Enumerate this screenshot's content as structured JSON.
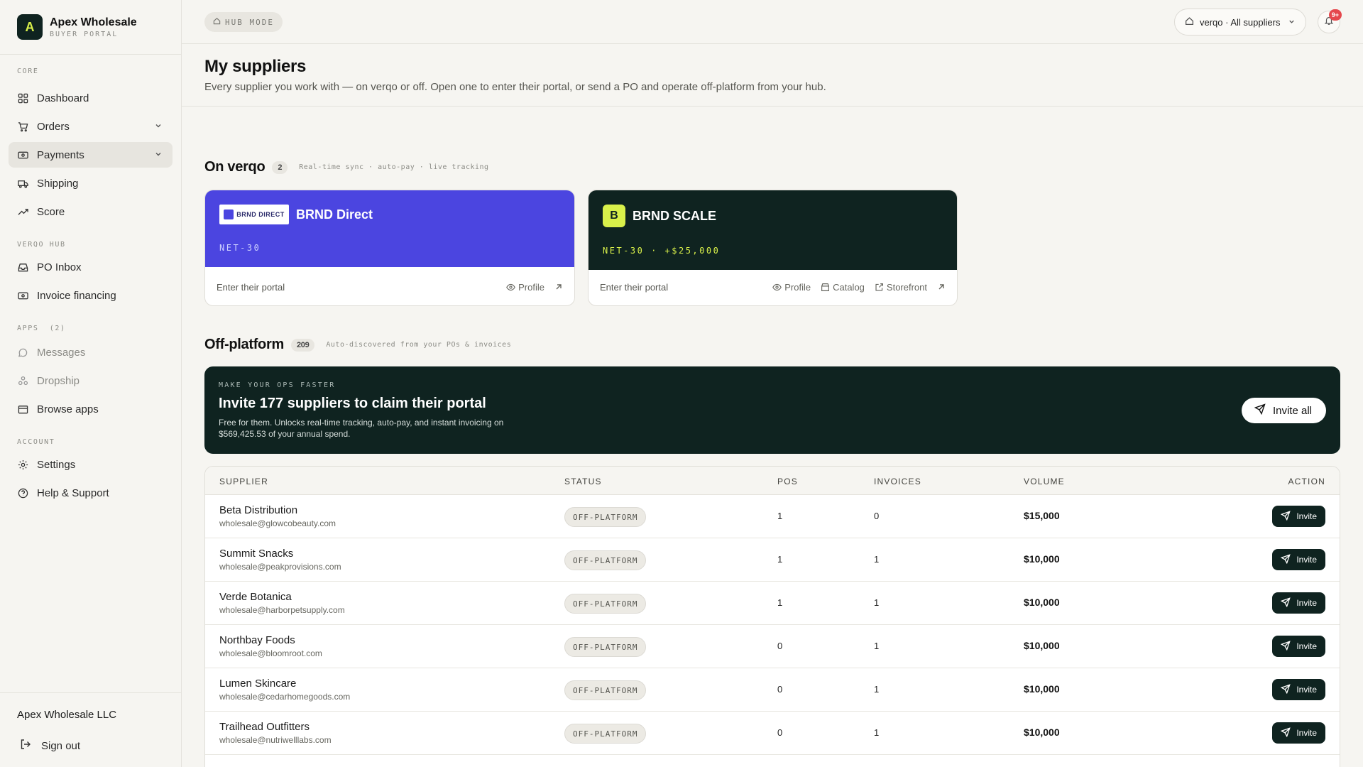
{
  "brand": {
    "initial": "A",
    "name": "Apex Wholesale",
    "sub": "BUYER PORTAL"
  },
  "nav": {
    "sections": [
      "CORE",
      "VERQO HUB",
      "APPS",
      "ACCOUNT"
    ],
    "apps_count": "(2)",
    "items": [
      {
        "label": "Dashboard"
      },
      {
        "label": "Orders"
      },
      {
        "label": "Payments"
      },
      {
        "label": "Shipping"
      },
      {
        "label": "Score"
      },
      {
        "label": "PO Inbox"
      },
      {
        "label": "Invoice financing"
      },
      {
        "label": "Messages"
      },
      {
        "label": "Dropship"
      },
      {
        "label": "Browse apps"
      },
      {
        "label": "Settings"
      },
      {
        "label": "Help & Support"
      }
    ]
  },
  "footer": {
    "company": "Apex Wholesale LLC",
    "signout": "Sign out"
  },
  "topbar": {
    "hub_mode": "HUB MODE",
    "scope": "verqo · All suppliers",
    "notif_count": "9+"
  },
  "page": {
    "title": "My suppliers",
    "subtitle": "Every supplier you work with — on verqo or off. Open one to enter their portal, or send a PO and operate off-platform from your hub."
  },
  "on_verqo": {
    "title": "On verqo",
    "count": "2",
    "note": "Real-time sync · auto-pay · live tracking",
    "cards": [
      {
        "logo_text": "BRND DIRECT",
        "name": "BRND Direct",
        "terms": "NET-30",
        "enter": "Enter their portal",
        "links": [
          "Profile"
        ]
      },
      {
        "logo_initial": "B",
        "name": "BRND SCALE",
        "terms": "NET-30 · +$25,000",
        "enter": "Enter their portal",
        "links": [
          "Profile",
          "Catalog",
          "Storefront"
        ]
      }
    ]
  },
  "off_platform": {
    "title": "Off-platform",
    "count": "209",
    "note": "Auto-discovered from your POs & invoices",
    "banner": {
      "kicker": "MAKE YOUR OPS FASTER",
      "title": "Invite 177 suppliers to claim their portal",
      "desc": "Free for them. Unlocks real-time tracking, auto-pay, and instant invoicing on $569,425.53 of your annual spend.",
      "button": "Invite all"
    },
    "columns": [
      "SUPPLIER",
      "STATUS",
      "POS",
      "INVOICES",
      "VOLUME",
      "ACTION"
    ],
    "rows": [
      {
        "name": "Beta Distribution",
        "email": "wholesale@glowcobeauty.com",
        "status": "OFF-PLATFORM",
        "pos": "1",
        "invoices": "0",
        "volume": "$15,000",
        "action": "Invite"
      },
      {
        "name": "Summit Snacks",
        "email": "wholesale@peakprovisions.com",
        "status": "OFF-PLATFORM",
        "pos": "1",
        "invoices": "1",
        "volume": "$10,000",
        "action": "Invite"
      },
      {
        "name": "Verde Botanica",
        "email": "wholesale@harborpetsupply.com",
        "status": "OFF-PLATFORM",
        "pos": "1",
        "invoices": "1",
        "volume": "$10,000",
        "action": "Invite"
      },
      {
        "name": "Northbay Foods",
        "email": "wholesale@bloomroot.com",
        "status": "OFF-PLATFORM",
        "pos": "0",
        "invoices": "1",
        "volume": "$10,000",
        "action": "Invite"
      },
      {
        "name": "Lumen Skincare",
        "email": "wholesale@cedarhomegoods.com",
        "status": "OFF-PLATFORM",
        "pos": "0",
        "invoices": "1",
        "volume": "$10,000",
        "action": "Invite"
      },
      {
        "name": "Trailhead Outfitters",
        "email": "wholesale@nutriwelllabs.com",
        "status": "OFF-PLATFORM",
        "pos": "0",
        "invoices": "1",
        "volume": "$10,000",
        "action": "Invite"
      }
    ]
  },
  "colors": {
    "accent_dark": "#0f2320",
    "brnd_direct": "#4b45e0",
    "lime": "#d9f04a"
  }
}
